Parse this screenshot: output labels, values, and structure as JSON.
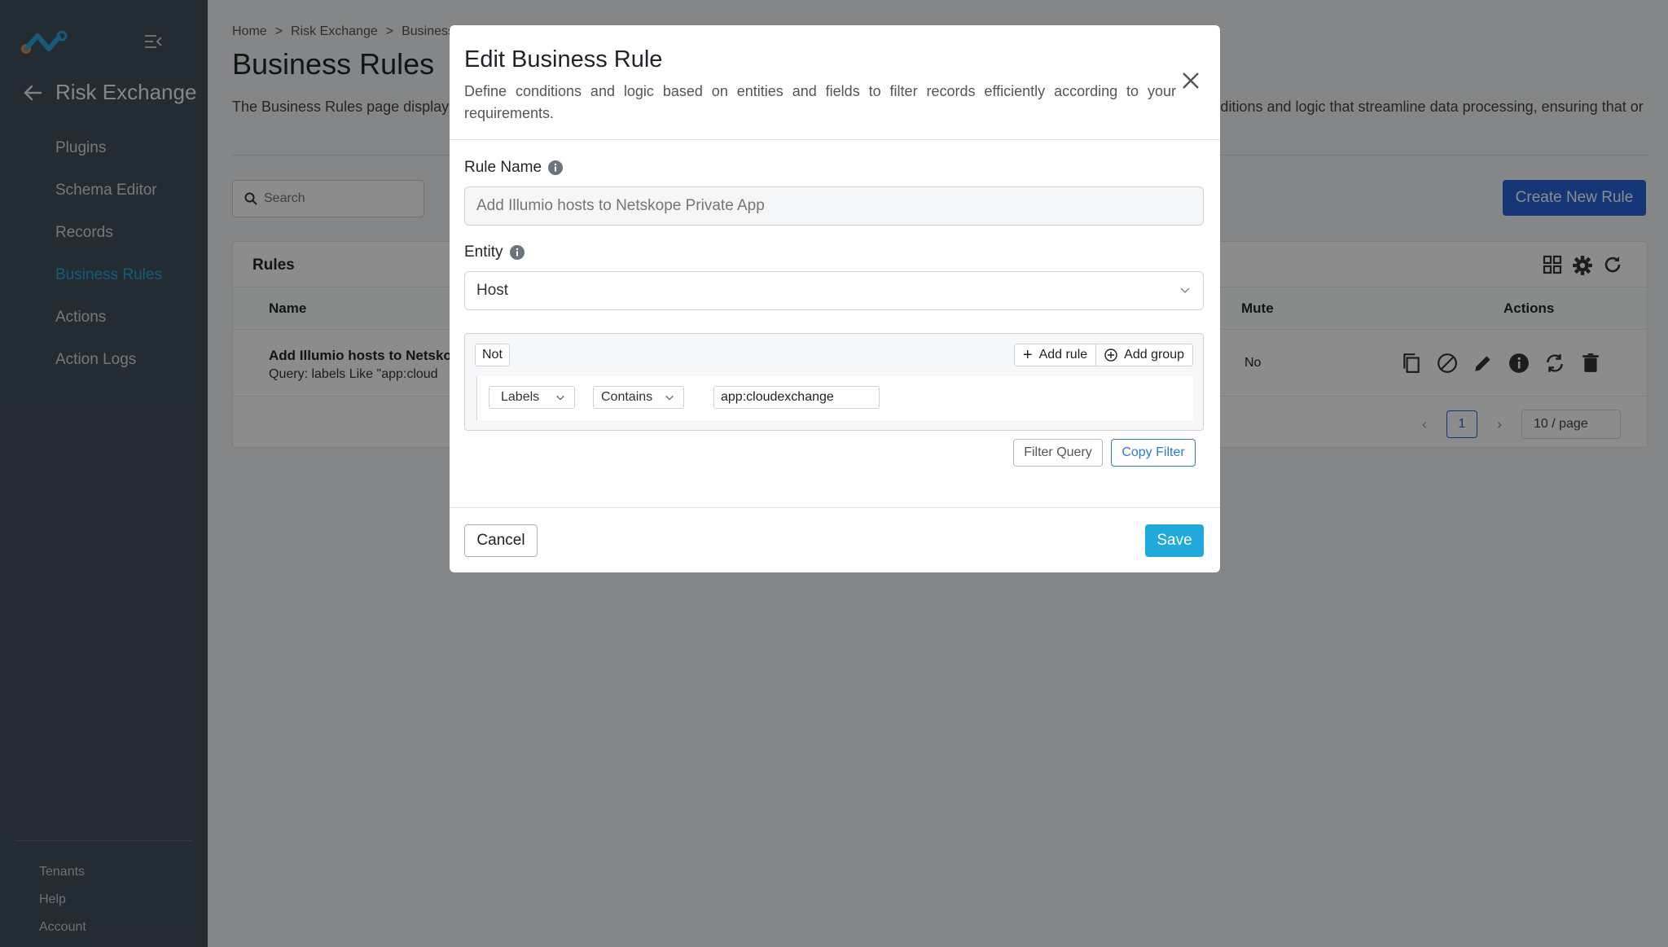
{
  "sidebar": {
    "back_label": "Risk Exchange",
    "items": [
      {
        "label": "Plugins"
      },
      {
        "label": "Schema Editor"
      },
      {
        "label": "Records"
      },
      {
        "label": "Business Rules"
      },
      {
        "label": "Actions"
      },
      {
        "label": "Action Logs"
      }
    ],
    "footer": [
      {
        "label": "Tenants"
      },
      {
        "label": "Help"
      },
      {
        "label": "Account"
      }
    ]
  },
  "main": {
    "breadcrumb": [
      "Home",
      ">",
      "Risk Exchange",
      ">",
      "Business"
    ],
    "title": "Business Rules",
    "description": "The Business Rules page display                                                                                                                                          e rules allow users to define conditions and logic that streamline data processing, ensuring that or",
    "search_placeholder": "Search",
    "create_button": "Create New Rule",
    "card_title": "Rules",
    "columns": {
      "name": "Name",
      "mute": "Mute",
      "actions": "Actions"
    },
    "row": {
      "name": "Add Illumio hosts to Netsko",
      "query": "Query: labels Like \"app:cloud",
      "mute": "No"
    },
    "pager": {
      "page": "1",
      "page_size": "10 / page"
    }
  },
  "modal": {
    "title": "Edit Business Rule",
    "description": "Define conditions and logic based on entities and fields to filter records efficiently according to your requirements.",
    "rule_name_label": "Rule Name",
    "rule_name_placeholder": "Add Illumio hosts to Netskope Private App",
    "entity_label": "Entity",
    "entity_value": "Host",
    "query_builder": {
      "not_label": "Not",
      "add_rule": "Add rule",
      "add_group": "Add group",
      "field": "Labels",
      "operator": "Contains",
      "value": "app:cloudexchange"
    },
    "filter_query_button": "Filter Query",
    "copy_filter_button": "Copy Filter",
    "cancel_button": "Cancel",
    "save_button": "Save"
  }
}
